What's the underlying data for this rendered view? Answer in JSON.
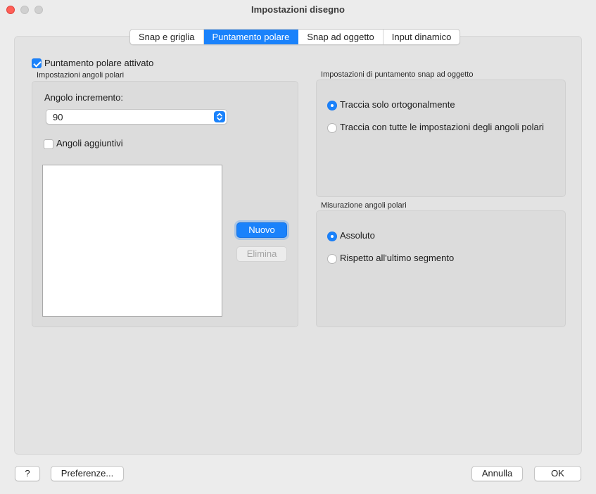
{
  "window": {
    "title": "Impostazioni disegno"
  },
  "tabs": [
    {
      "label": "Snap e griglia",
      "active": false
    },
    {
      "label": "Puntamento polare",
      "active": true
    },
    {
      "label": "Snap ad oggetto",
      "active": false
    },
    {
      "label": "Input dinamico",
      "active": false
    }
  ],
  "polar_tracking": {
    "enabled_label": "Puntamento polare attivato",
    "enabled": true
  },
  "polar_angle_settings": {
    "group_label": "Impostazioni angoli polari",
    "increment_label": "Angolo incremento:",
    "increment_value": "90",
    "additional_label": "Angoli aggiuntivi",
    "additional_checked": false,
    "angles": [],
    "new_button": "Nuovo",
    "delete_button": "Elimina"
  },
  "object_snap_tracking": {
    "group_label": "Impostazioni di puntamento snap ad oggetto",
    "options": [
      {
        "label": "Traccia solo ortogonalmente",
        "selected": true
      },
      {
        "label": "Traccia con tutte le impostazioni degli angoli polari",
        "selected": false
      }
    ]
  },
  "polar_measurement": {
    "group_label": "Misurazione angoli polari",
    "options": [
      {
        "label": "Assoluto",
        "selected": true
      },
      {
        "label": "Rispetto all'ultimo segmento",
        "selected": false
      }
    ]
  },
  "footer": {
    "help_button": "?",
    "preferences_button": "Preferenze...",
    "cancel_button": "Annulla",
    "ok_button": "OK"
  },
  "colors": {
    "accent": "#1a82fb",
    "close": "#ff5f57"
  }
}
